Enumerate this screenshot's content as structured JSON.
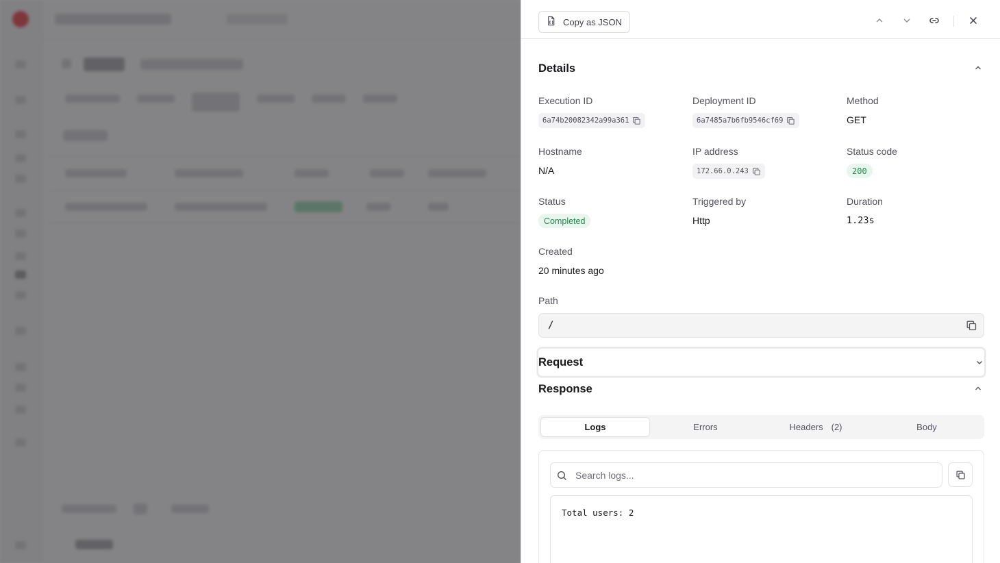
{
  "header": {
    "copy_json_label": "Copy as JSON",
    "icons": [
      "file-json-icon",
      "chevron-up-icon",
      "chevron-down-icon",
      "link-icon",
      "close-icon"
    ]
  },
  "details": {
    "title": "Details",
    "execution_id": {
      "label": "Execution ID",
      "value": "6a74b20082342a99a361"
    },
    "deployment_id": {
      "label": "Deployment ID",
      "value": "6a7485a7b6fb9546cf69"
    },
    "method": {
      "label": "Method",
      "value": "GET"
    },
    "hostname": {
      "label": "Hostname",
      "value": "N/A"
    },
    "ip_address": {
      "label": "IP address",
      "value": "172.66.0.243"
    },
    "status_code": {
      "label": "Status code",
      "value": "200"
    },
    "status": {
      "label": "Status",
      "value": "Completed"
    },
    "triggered_by": {
      "label": "Triggered by",
      "value": "Http"
    },
    "duration": {
      "label": "Duration",
      "value": "1.23s"
    },
    "created": {
      "label": "Created",
      "value": "20 minutes ago"
    },
    "path": {
      "label": "Path",
      "value": "/"
    }
  },
  "request": {
    "title": "Request"
  },
  "response": {
    "title": "Response",
    "tabs": [
      {
        "label": "Logs",
        "count": ""
      },
      {
        "label": "Errors",
        "count": ""
      },
      {
        "label": "Headers",
        "count": "(2)"
      },
      {
        "label": "Body",
        "count": ""
      }
    ],
    "active_tab": "Logs",
    "search_placeholder": "Search logs...",
    "log_lines": [
      "Total users: 2"
    ]
  },
  "colors": {
    "success_bg": "#e8f6ee",
    "success_text": "#1f8a4c",
    "overlay": "#28282c"
  }
}
